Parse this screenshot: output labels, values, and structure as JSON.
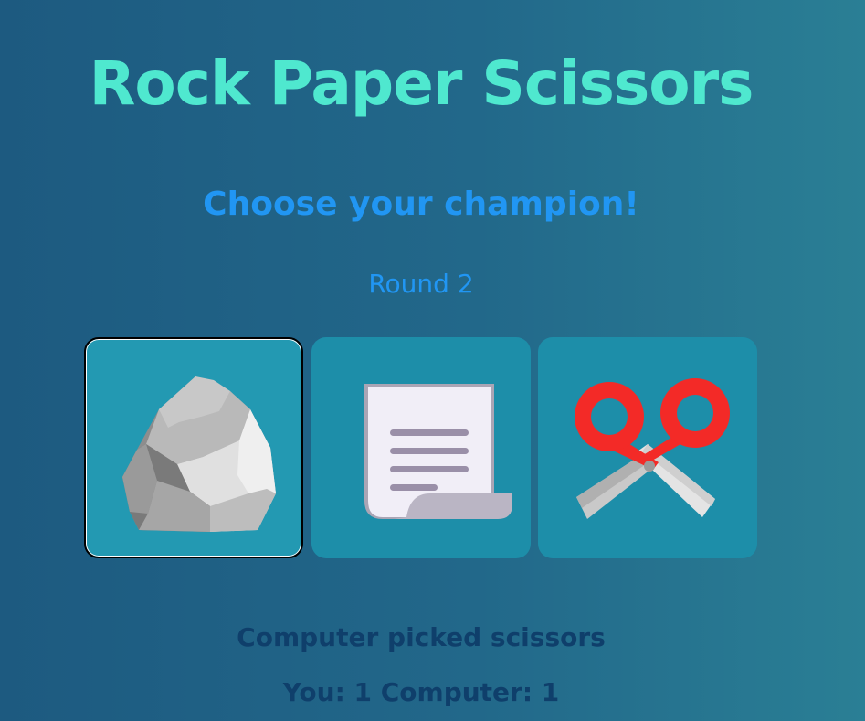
{
  "game": {
    "title": "Rock Paper Scissors",
    "prompt": "Choose your champion!",
    "round_label": "Round 2"
  },
  "choices": [
    {
      "name": "rock",
      "icon": "rock-icon",
      "selected": true
    },
    {
      "name": "paper",
      "icon": "paper-scroll-icon",
      "selected": false
    },
    {
      "name": "scissors",
      "icon": "scissors-icon",
      "selected": false
    }
  ],
  "result": {
    "message": "Computer picked scissors"
  },
  "score": {
    "text": "You: 1 Computer: 1",
    "you": 1,
    "computer": 1
  },
  "colors": {
    "title": "#4fe8cf",
    "accent": "#2196f3",
    "result_text": "#0f3f6b",
    "card": "#1d8ea9"
  }
}
